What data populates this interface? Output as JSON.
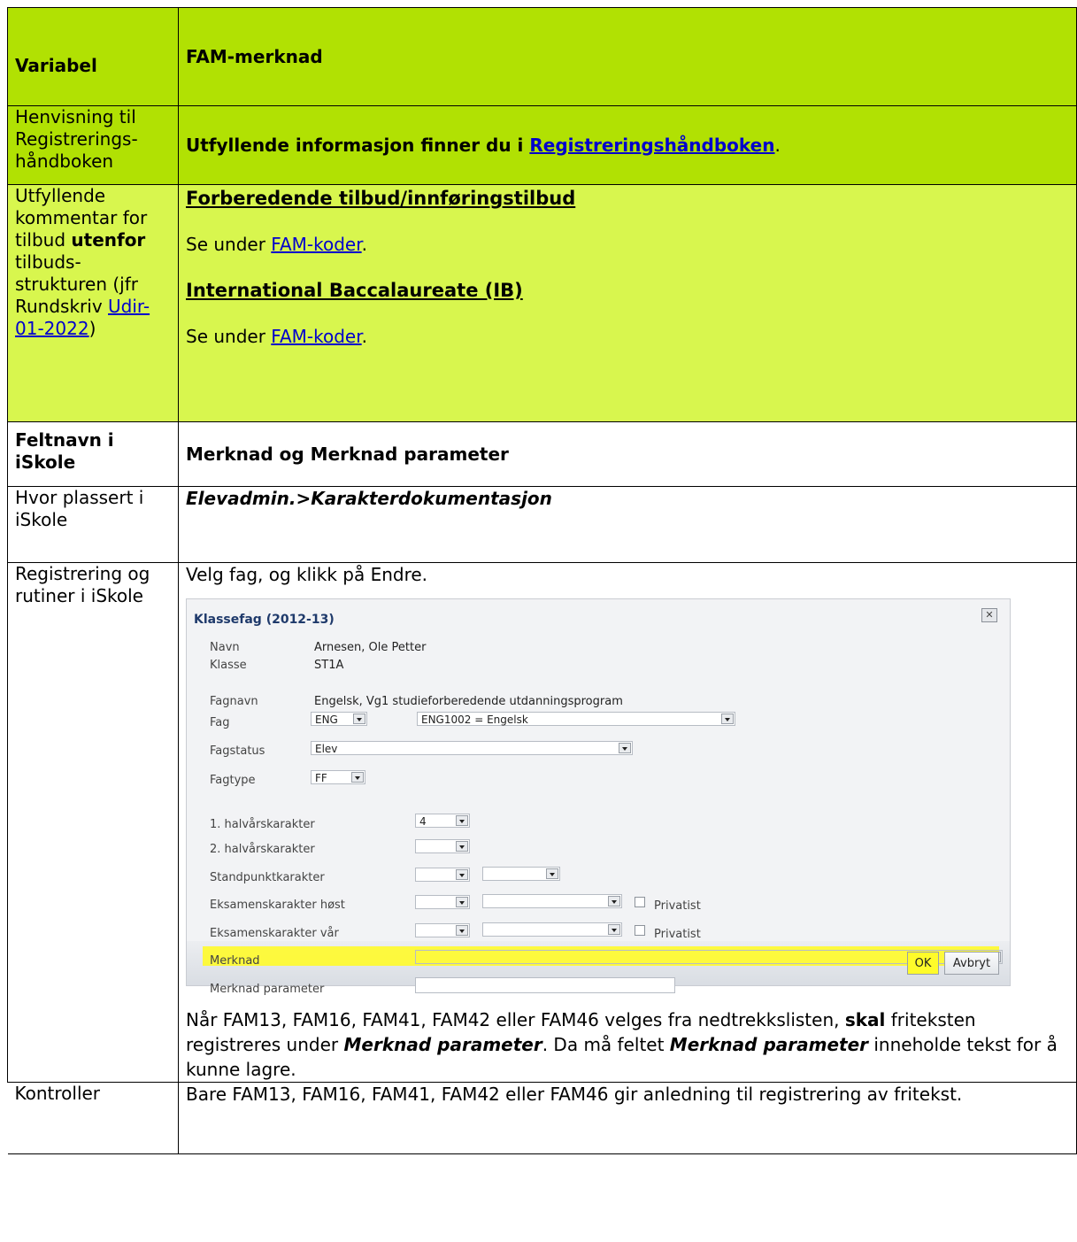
{
  "header": {
    "label": "Variabel",
    "title": "FAM-merknad"
  },
  "reference": {
    "label": "Henvisning til Registrerings-håndboken",
    "text_prefix": "Utfyllende informasjon finner du i ",
    "link": "Registreringshåndboken",
    "text_suffix": "."
  },
  "comment": {
    "label_1": "Utfyllende kommentar for tilbud",
    "label_bold": "utenfor",
    "label_2": "tilbuds-strukturen (jfr Rundskriv",
    "label_link": "Udir-01-2022",
    "label_end": ")",
    "section1_title": "Forberedende tilbud/innføringstilbud",
    "section1_prefix": "Se under ",
    "section1_link": "FAM-koder",
    "section1_suffix": ".",
    "section2_title": "International Baccalaureate (IB)",
    "section2_prefix": "Se under ",
    "section2_link": "FAM-koder",
    "section2_suffix": "."
  },
  "field": {
    "label": "Feltnavn i iSkole",
    "value": "Merknad og Merknad parameter"
  },
  "location": {
    "label": "Hvor plassert i iSkole",
    "value": "Elevadmin.>Karakterdokumentasjon"
  },
  "registration": {
    "label": "Registrering og rutiner i iSkole",
    "intro": "Velg fag, og klikk på Endre.",
    "dialog": {
      "title": "Klassefag (2012-13)",
      "navn_label": "Navn",
      "navn_value": "Arnesen, Ole Petter",
      "klasse_label": "Klasse",
      "klasse_value": "ST1A",
      "fagnavn_label": "Fagnavn",
      "fagnavn_value": "Engelsk, Vg1 studieforberedende utdanningsprogram",
      "fag_label": "Fag",
      "fag_code": "ENG",
      "fag_full": "ENG1002 = Engelsk",
      "fagstatus_label": "Fagstatus",
      "fagstatus_value": "Elev",
      "fagtype_label": "Fagtype",
      "fagtype_value": "FF",
      "halv1_label": "1. halvårskarakter",
      "halv1_value": "4",
      "halv2_label": "2. halvårskarakter",
      "standpunkt_label": "Standpunktkarakter",
      "eks_host_label": "Eksamenskarakter høst",
      "eks_var_label": "Eksamenskarakter vår",
      "privatist_label": "Privatist",
      "merknad_label": "Merknad",
      "merknad_param_label": "Merknad parameter",
      "ok_label": "OK",
      "cancel_label": "Avbryt"
    },
    "note_1": "Når FAM13, FAM16, FAM41, FAM42 eller FAM46 velges fra nedtrekkslisten, ",
    "note_bold_1": "skal",
    "note_2": " friteksten registreres under ",
    "note_bold_2": "Merknad parameter",
    "note_3": ". Da må feltet ",
    "note_bold_3": "Merknad parameter",
    "note_4": " inneholde tekst for å kunne lagre."
  },
  "controls": {
    "label": "Kontroller",
    "value": "Bare FAM13, FAM16, FAM41, FAM42 eller FAM46 gir anledning til registrering av fritekst."
  },
  "colors": {
    "header_green": "#b1e103",
    "light_green": "#d8f64e",
    "highlight_yellow": "#fffb2a",
    "link_blue": "#0000cc"
  }
}
